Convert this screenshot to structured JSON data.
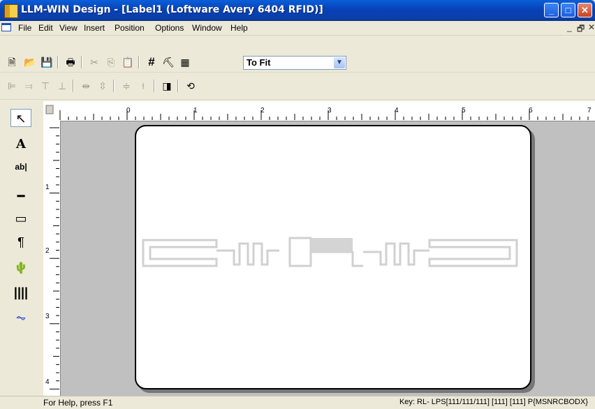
{
  "window": {
    "title": "LLM-WIN Design - [Label1 (Loftware Avery 6404 RFID)]",
    "buttons": {
      "minimize": "_",
      "maximize": "□",
      "close": "✕"
    }
  },
  "menu": {
    "items": [
      {
        "label": "File"
      },
      {
        "label": "Edit"
      },
      {
        "label": "View"
      },
      {
        "label": "Insert"
      },
      {
        "label": "Position"
      },
      {
        "label": "Options"
      },
      {
        "label": "Window"
      },
      {
        "label": "Help"
      }
    ],
    "mdi_minimize": "_",
    "mdi_restore": "🗗",
    "mdi_close": "✕"
  },
  "toolbar1": {
    "icons": [
      {
        "name": "new-icon",
        "glyph": "🗎"
      },
      {
        "name": "open-icon",
        "glyph": "📂"
      },
      {
        "name": "save-icon",
        "glyph": "💾"
      },
      {
        "name": "print-icon",
        "glyph": "🖶"
      },
      {
        "name": "cut-icon",
        "glyph": "✂"
      },
      {
        "name": "copy-icon",
        "glyph": "⎘"
      },
      {
        "name": "paste-icon",
        "glyph": "📋"
      },
      {
        "name": "grid-icon",
        "glyph": "#"
      },
      {
        "name": "properties-icon",
        "glyph": "⛏"
      },
      {
        "name": "label-layout-icon",
        "glyph": "▦"
      }
    ],
    "zoom_value": "To Fit"
  },
  "toolbar2": {
    "icons": [
      {
        "name": "align-left-icon",
        "glyph": "⊫"
      },
      {
        "name": "align-right-icon",
        "glyph": "⫤"
      },
      {
        "name": "align-top-icon",
        "glyph": "⊤"
      },
      {
        "name": "align-bottom-icon",
        "glyph": "⊥"
      },
      {
        "name": "space-horizontal-icon",
        "glyph": "⇹"
      },
      {
        "name": "space-vertical-icon",
        "glyph": "⇳"
      },
      {
        "name": "center-horizontal-icon",
        "glyph": "≑"
      },
      {
        "name": "center-vertical-icon",
        "glyph": "⫮"
      },
      {
        "name": "bring-front-icon",
        "glyph": "◨"
      },
      {
        "name": "rotate-icon",
        "glyph": "⟲"
      }
    ]
  },
  "tools": [
    {
      "name": "select-tool-icon",
      "glyph": "↖"
    },
    {
      "name": "text-tool-icon",
      "glyph": "A"
    },
    {
      "name": "text-field-tool-icon",
      "glyph": "ab|"
    },
    {
      "name": "line-tool-icon",
      "glyph": "━"
    },
    {
      "name": "box-tool-icon",
      "glyph": "▭"
    },
    {
      "name": "paragraph-tool-icon",
      "glyph": "¶"
    },
    {
      "name": "image-tool-icon",
      "glyph": "🌵"
    },
    {
      "name": "barcode-tool-icon",
      "glyph": "||||"
    },
    {
      "name": "rfid-tool-icon",
      "glyph": "⏦"
    }
  ],
  "rulers": {
    "horizontal": [
      "0",
      "1",
      "2",
      "3",
      "4",
      "5",
      "6",
      "7"
    ],
    "vertical": [
      "1",
      "2",
      "3",
      "4"
    ]
  },
  "status": {
    "help": "For Help, press F1",
    "key": "Key: RL- LPS[111/111/111] [111] [111] P{MSNRCBODX}"
  }
}
